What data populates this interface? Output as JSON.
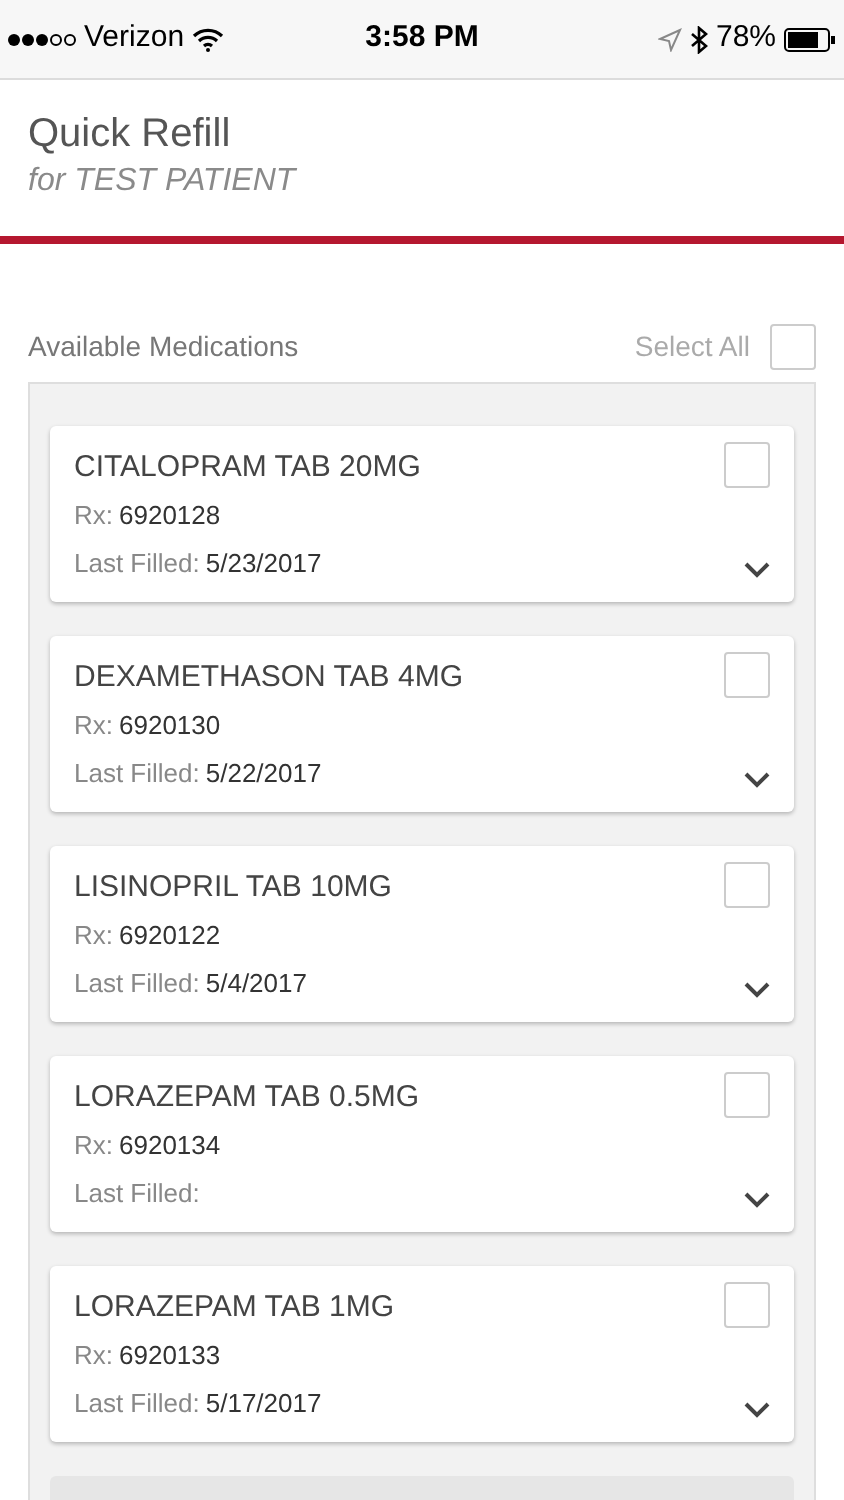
{
  "status_bar": {
    "carrier": "Verizon",
    "time": "3:58 PM",
    "battery": "78%"
  },
  "header": {
    "title": "Quick Refill",
    "subtitle": "for TEST PATIENT"
  },
  "section": {
    "label": "Available Medications",
    "select_all": {
      "label": "Select All",
      "checked": false
    }
  },
  "medications": [
    {
      "name": "CITALOPRAM TAB 20MG",
      "rx_label": "Rx:",
      "rx": "6920128",
      "filled_label": "Last Filled:",
      "filled": "5/23/2017",
      "checked": false
    },
    {
      "name": "DEXAMETHASON TAB 4MG",
      "rx_label": "Rx:",
      "rx": "6920130",
      "filled_label": "Last Filled:",
      "filled": "5/22/2017",
      "checked": false
    },
    {
      "name": "LISINOPRIL TAB 10MG",
      "rx_label": "Rx:",
      "rx": "6920122",
      "filled_label": "Last Filled:",
      "filled": "5/4/2017",
      "checked": false
    },
    {
      "name": "LORAZEPAM TAB 0.5MG",
      "rx_label": "Rx:",
      "rx": "6920134",
      "filled_label": "Last Filled:",
      "checked": false
    },
    {
      "name": "LORAZEPAM TAB 1MG",
      "rx_label": "Rx:",
      "rx": "6920133",
      "filled_label": "Last Filled:",
      "filled": "5/17/2017",
      "checked": false
    }
  ]
}
